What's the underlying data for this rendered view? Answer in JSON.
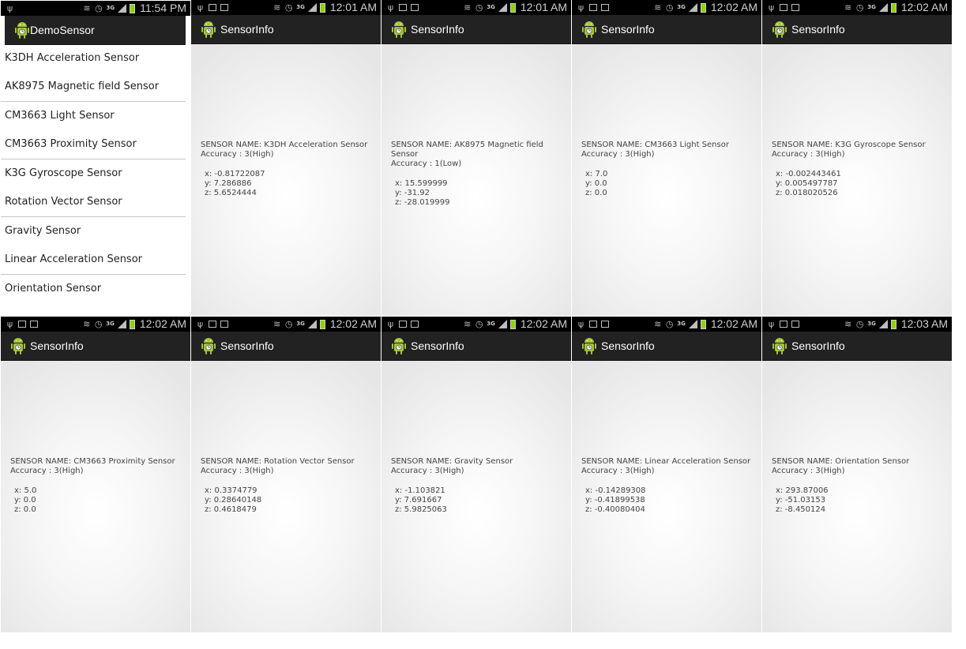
{
  "list_screen": {
    "status_time": "11:54 PM",
    "title": "DemoSensor",
    "items": [
      "K3DH Acceleration Sensor",
      "AK8975 Magnetic field Sensor",
      "CM3663 Light Sensor",
      "CM3663 Proximity Sensor",
      "K3G Gyroscope Sensor",
      "Rotation Vector Sensor",
      "Gravity Sensor",
      "Linear Acceleration Sensor",
      "Orientation Sensor"
    ]
  },
  "detail_screens": [
    {
      "time": "12:01 AM",
      "title": "SensorInfo",
      "name": "SENSOR NAME: K3DH Acceleration Sensor",
      "accuracy": "Accuracy : 3(High)",
      "x": "x: -0.81722087",
      "y": "y: 7.286886",
      "z": "z: 5.6524444"
    },
    {
      "time": "12:01 AM",
      "title": "SensorInfo",
      "name": "SENSOR NAME: AK8975 Magnetic field",
      "name2": "Sensor",
      "accuracy": "Accuracy : 1(Low)",
      "x": "x: 15.599999",
      "y": "y: -31.92",
      "z": "z: -28.019999"
    },
    {
      "time": "12:02 AM",
      "title": "SensorInfo",
      "name": "SENSOR NAME: CM3663 Light Sensor",
      "accuracy": "Accuracy : 3(High)",
      "x": "x: 7.0",
      "y": "y: 0.0",
      "z": "z: 0.0"
    },
    {
      "time": "12:02 AM",
      "title": "SensorInfo",
      "name": "SENSOR NAME: K3G Gyroscope Sensor",
      "accuracy": "Accuracy : 3(High)",
      "x": "x: -0.002443461",
      "y": "y: 0.005497787",
      "z": "z: 0.018020526"
    },
    {
      "time": "12:02 AM",
      "title": "SensorInfo",
      "name": "SENSOR NAME: CM3663 Proximity Sensor",
      "accuracy": "Accuracy : 3(High)",
      "x": "x: 5.0",
      "y": "y: 0.0",
      "z": "z: 0.0"
    },
    {
      "time": "12:02 AM",
      "title": "SensorInfo",
      "name": "SENSOR NAME: Rotation Vector Sensor",
      "accuracy": "Accuracy : 3(High)",
      "x": "x: 0.3374779",
      "y": "y: 0.28640148",
      "z": "z: 0.4618479"
    },
    {
      "time": "12:02 AM",
      "title": "SensorInfo",
      "name": "SENSOR NAME: Gravity Sensor",
      "accuracy": "Accuracy : 3(High)",
      "x": "x: -1.103821",
      "y": "y: 7.691667",
      "z": "z: 5.9825063"
    },
    {
      "time": "12:02 AM",
      "title": "SensorInfo",
      "name": "SENSOR NAME: Linear Acceleration Sensor",
      "accuracy": "Accuracy : 3(High)",
      "x": "x: -0.14289308",
      "y": "y: -0.41899538",
      "z": "z: -0.40080404"
    },
    {
      "time": "12:03 AM",
      "title": "SensorInfo",
      "name": "SENSOR NAME: Orientation Sensor",
      "accuracy": "Accuracy : 3(High)",
      "x": "x: 293.87006",
      "y": "y: -51.03153",
      "z": "z: -8.450124"
    }
  ],
  "status_icons": [
    "usb-icon",
    "image-icon",
    "screenshot-icon",
    "mute-icon",
    "alarm-icon",
    "3g-icon",
    "signal-icon",
    "battery-icon"
  ],
  "colors": {
    "action_bar": "#222222",
    "status_bar": "#000000",
    "battery": "#8bd400",
    "android_green": "#a4c639"
  }
}
